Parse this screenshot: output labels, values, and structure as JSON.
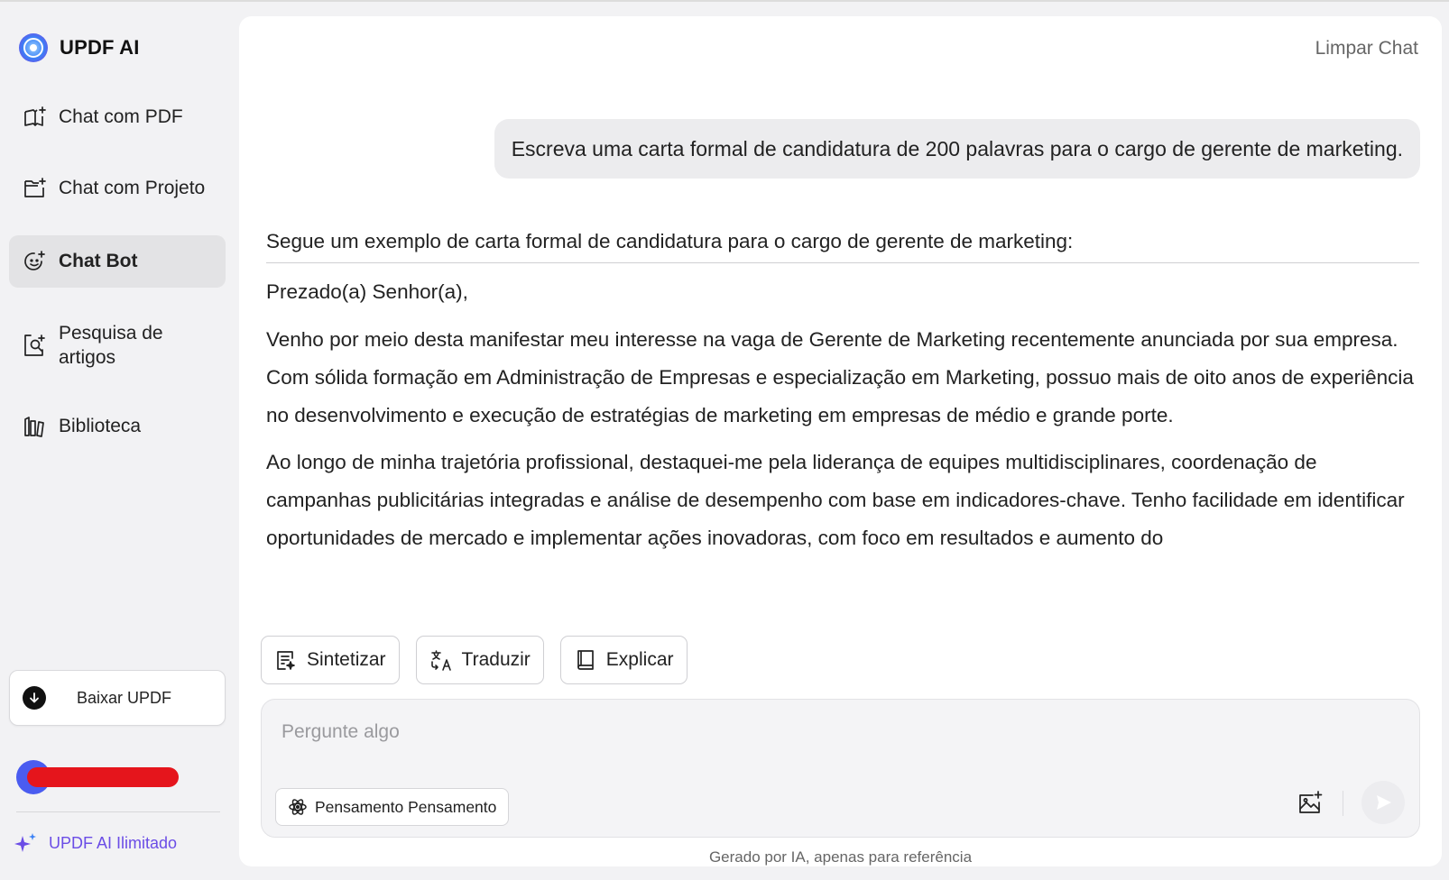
{
  "brand": {
    "name": "UPDF AI",
    "logo_icon": "updf-ai-logo-icon"
  },
  "sidebar": {
    "items": [
      {
        "label": "Chat com PDF",
        "icon": "book-sparkle-icon",
        "active": false
      },
      {
        "label": "Chat com Projeto",
        "icon": "folder-sparkle-icon",
        "active": false
      },
      {
        "label": "Chat Bot",
        "icon": "bot-face-icon",
        "active": true
      },
      {
        "label": "Pesquisa de artigos",
        "icon": "document-search-icon",
        "active": false
      },
      {
        "label": "Biblioteca",
        "icon": "library-icon",
        "active": false
      }
    ],
    "download_label": "Baixar UPDF",
    "upgrade_label": "UPDF AI Ilimitado"
  },
  "header": {
    "clear_chat": "Limpar Chat"
  },
  "chat": {
    "user_message": "Escreva uma carta formal de candidatura de 200 palavras para o cargo de gerente de marketing.",
    "response": {
      "intro": "Segue um exemplo de carta formal de candidatura para o cargo de gerente de marketing:",
      "greeting": "Prezado(a) Senhor(a),",
      "paragraphs": [
        "Venho por meio desta manifestar meu interesse na vaga de Gerente de Marketing recentemente anunciada por sua empresa. Com sólida formação em Administração de Empresas e especialização em Marketing, possuo mais de oito anos de experiência no desenvolvimento e execução de estratégias de marketing em empresas de médio e grande porte.",
        "Ao longo de minha trajetória profissional, destaquei-me pela liderança de equipes multidisciplinares, coordenação de campanhas publicitárias integradas e análise de desempenho com base em indicadores-chave. Tenho facilidade em identificar oportunidades de mercado e implementar ações inovadoras, com foco em resultados e aumento do"
      ]
    }
  },
  "actions": {
    "summarize": "Sintetizar",
    "translate": "Traduzir",
    "explain": "Explicar"
  },
  "composer": {
    "placeholder": "Pergunte algo",
    "value": "",
    "thinking_label": "Pensamento Pensamento"
  },
  "footer": {
    "disclaimer": "Gerado por IA, apenas para referência"
  },
  "colors": {
    "accent_purple": "#6b4de6",
    "active_bg": "#e3e3e5",
    "logo_blue": "#3b82f6",
    "redaction_red": "#e5151c",
    "avatar_blue": "#4a5cf0"
  }
}
